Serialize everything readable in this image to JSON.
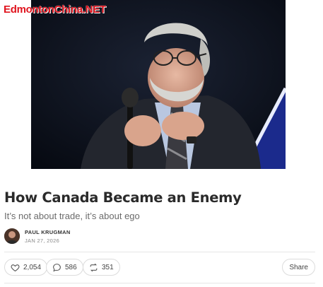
{
  "watermark": "EdmontonChina.NET",
  "article": {
    "title": "How Canada Became an Enemy",
    "subtitle": "It’s not about trade, it’s about ego",
    "author": "PAUL KRUGMAN",
    "date": "JAN 27, 2026"
  },
  "actions": {
    "likes": "2,054",
    "comments": "586",
    "restacks": "351",
    "share_label": "Share"
  },
  "colors": {
    "watermark": "#e0141e",
    "title": "#2a2a2a",
    "subtitle": "#6b6b6b"
  },
  "icons": [
    "heart-icon",
    "comment-icon",
    "restack-icon"
  ]
}
